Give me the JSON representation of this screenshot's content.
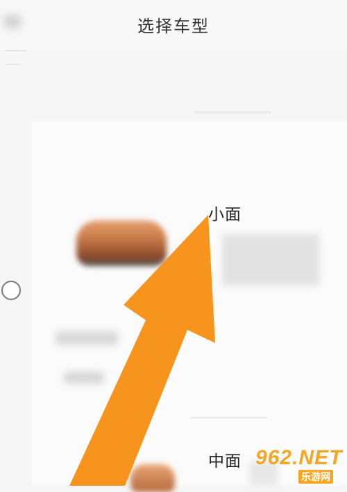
{
  "header": {
    "title": "选择车型"
  },
  "vehicle_types": [
    {
      "label": "小面"
    },
    {
      "label": "中面"
    }
  ],
  "watermark": {
    "main": "962.NET",
    "sub": "乐游网"
  },
  "colors": {
    "arrow": "#F7941D",
    "background": "#F6F6F6"
  }
}
